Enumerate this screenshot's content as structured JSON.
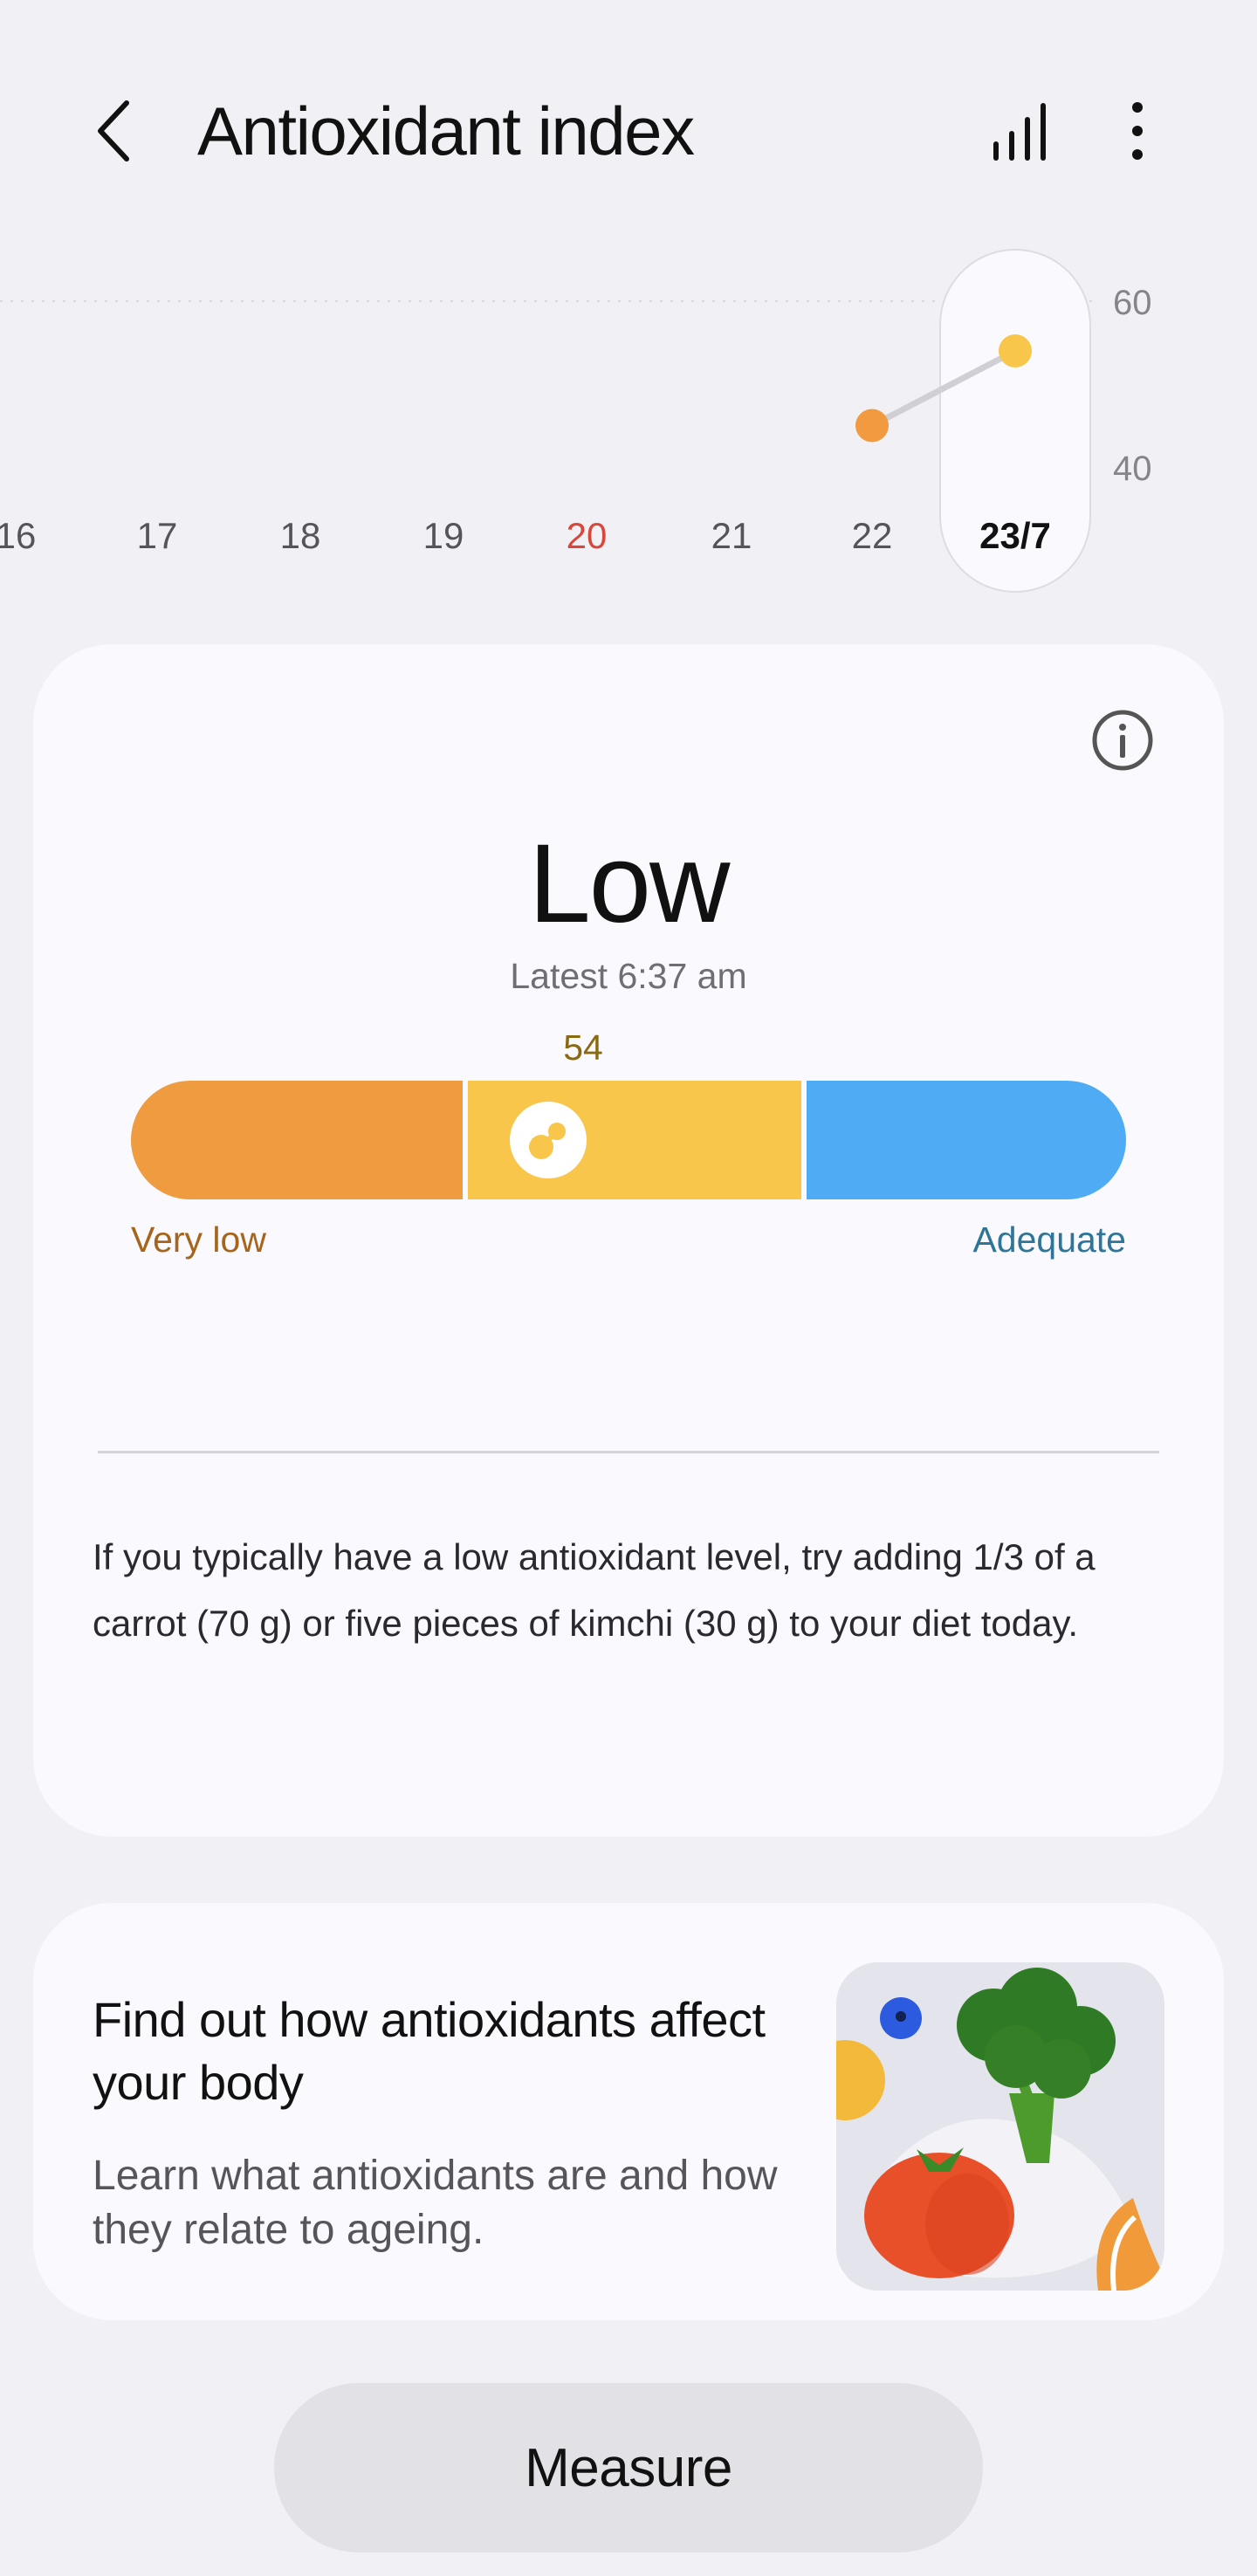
{
  "header": {
    "title": "Antioxidant index",
    "back_icon": "chevron-left-icon",
    "stats_icon": "bar-chart-icon",
    "more_icon": "more-vertical-icon"
  },
  "trend": {
    "x_labels": [
      "16",
      "17",
      "18",
      "19",
      "20",
      "21",
      "22",
      "23/7"
    ],
    "highlight_label": "20",
    "selected_label": "23/7",
    "y_ticks": [
      "60",
      "40"
    ],
    "y_range": [
      40,
      60
    ],
    "points": [
      {
        "day": "22",
        "value": 45,
        "color": "#f29a3f"
      },
      {
        "day": "23/7",
        "value": 54,
        "color": "#f7c64b"
      }
    ],
    "colors": {
      "highlight": "#d9473a",
      "selected_text": "#111111",
      "axis_text": "#555559",
      "line": "#cfcfd4"
    }
  },
  "card": {
    "info_icon": "info-icon",
    "status": "Low",
    "latest": "Latest 6:37 am",
    "value": "54",
    "value_fraction": 0.54,
    "scale_low": "Very low",
    "scale_high": "Adequate",
    "advice": "If you typically have a low antioxidant level, try adding 1/3 of a carrot (70 g) or five pieces of kimchi (30 g) to your diet today.",
    "colors": {
      "very_low": "#ef9b40",
      "low": "#f7c64b",
      "adequate": "#4fabf3"
    }
  },
  "learn": {
    "title": "Find out how antioxidants affect your body",
    "description": "Learn what antioxidants are and how they relate to ageing.",
    "image_icon": "vegetables-illustration"
  },
  "measure_button": "Measure"
}
